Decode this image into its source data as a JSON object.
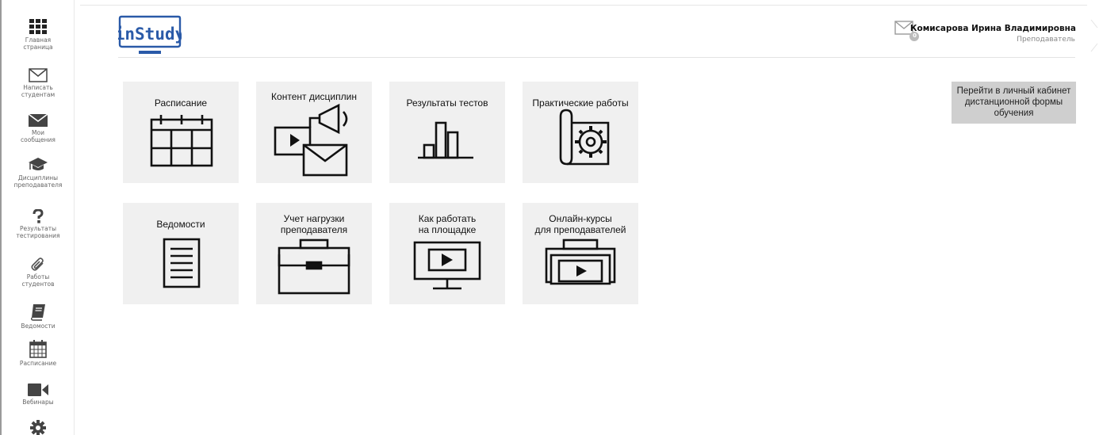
{
  "sidebar": {
    "items": [
      {
        "label": "Главная\nстраница",
        "icon": "grid-icon"
      },
      {
        "label": "Написать\nстудентам",
        "icon": "envelope-outline-icon"
      },
      {
        "label": "Мои\nсообщения",
        "icon": "envelope-filled-icon"
      },
      {
        "label": "Дисциплины\nпреподавателя",
        "icon": "graduation-cap-icon"
      },
      {
        "label": "Результаты\nтестирования",
        "icon": "question-icon"
      },
      {
        "label": "Работы\nстудентов",
        "icon": "paperclip-icon"
      },
      {
        "label": "Ведомости",
        "icon": "book-icon"
      },
      {
        "label": "Расписание",
        "icon": "calendar-icon"
      },
      {
        "label": "Вебинары",
        "icon": "video-camera-icon"
      },
      {
        "label": "",
        "icon": "gear-icon"
      }
    ]
  },
  "header": {
    "logo_text": "inStudy",
    "unread_count": "0",
    "user_name": "Комисарова Ирина Владимировна",
    "user_role": "Преподаватель"
  },
  "tiles": [
    {
      "label": "Расписание",
      "icon": "calendar-icon"
    },
    {
      "label": "Контент дисциплин",
      "icon": "media-content-icon"
    },
    {
      "label": "Результаты тестов",
      "icon": "bar-chart-icon"
    },
    {
      "label": "Практические работы",
      "icon": "blueprint-gear-icon"
    },
    {
      "label": "Ведомости",
      "icon": "document-icon"
    },
    {
      "label": "Учет нагрузки\nпреподавателя",
      "icon": "briefcase-icon"
    },
    {
      "label": "Как работать\nна площадке",
      "icon": "monitor-play-icon"
    },
    {
      "label": "Онлайн-курсы\nдля преподавателей",
      "icon": "video-case-icon"
    }
  ],
  "cabinet_button": "Перейти в личный кабинет дистанционной формы обучения",
  "colors": {
    "brand_blue": "#2a5aa8",
    "tile_bg": "#f0f0f0",
    "button_bg": "#cfcfcf"
  }
}
